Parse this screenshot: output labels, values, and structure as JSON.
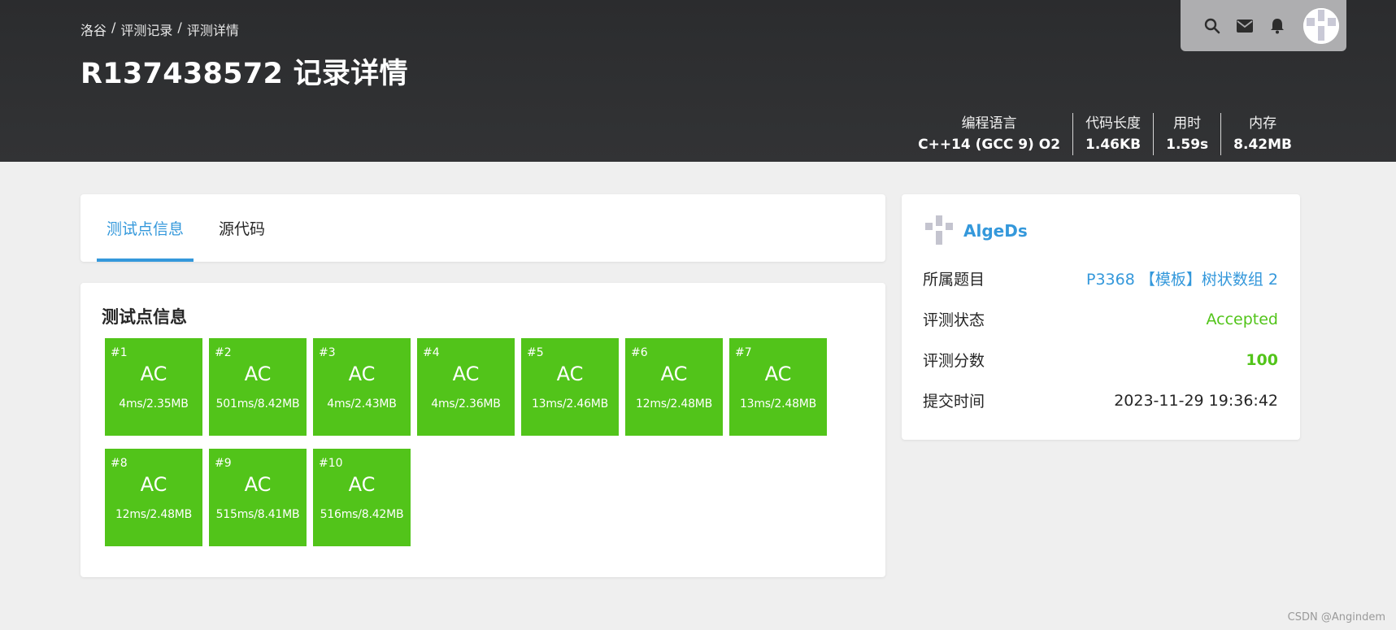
{
  "breadcrumb": {
    "home": "洛谷",
    "sep1": "/",
    "records": "评测记录",
    "sep2": "/",
    "current": "评测详情"
  },
  "page": {
    "title": "R137438572 记录详情"
  },
  "nav": {
    "icons": [
      "search-icon",
      "mail-icon",
      "bell-icon",
      "avatar"
    ]
  },
  "stats": [
    {
      "label": "编程语言",
      "value": "C++14 (GCC 9) O2"
    },
    {
      "label": "代码长度",
      "value": "1.46KB"
    },
    {
      "label": "用时",
      "value": "1.59s"
    },
    {
      "label": "内存",
      "value": "8.42MB"
    }
  ],
  "tabs": [
    {
      "label": "测试点信息",
      "active": true
    },
    {
      "label": "源代码",
      "active": false
    }
  ],
  "cases": {
    "title": "测试点信息",
    "items": [
      {
        "id": "#1",
        "status": "AC",
        "info": "4ms/2.35MB"
      },
      {
        "id": "#2",
        "status": "AC",
        "info": "501ms/8.42MB"
      },
      {
        "id": "#3",
        "status": "AC",
        "info": "4ms/2.43MB"
      },
      {
        "id": "#4",
        "status": "AC",
        "info": "4ms/2.36MB"
      },
      {
        "id": "#5",
        "status": "AC",
        "info": "13ms/2.46MB"
      },
      {
        "id": "#6",
        "status": "AC",
        "info": "12ms/2.48MB"
      },
      {
        "id": "#7",
        "status": "AC",
        "info": "13ms/2.48MB"
      },
      {
        "id": "#8",
        "status": "AC",
        "info": "12ms/2.48MB"
      },
      {
        "id": "#9",
        "status": "AC",
        "info": "515ms/8.41MB"
      },
      {
        "id": "#10",
        "status": "AC",
        "info": "516ms/8.42MB"
      }
    ]
  },
  "info": {
    "username": "AlgeDs",
    "problem_label": "所属题目",
    "problem_value": "P3368 【模板】树状数组 2",
    "status_label": "评测状态",
    "status_value": "Accepted",
    "score_label": "评测分数",
    "score_value": "100",
    "time_label": "提交时间",
    "time_value": "2023-11-29 19:36:42"
  },
  "watermark": "CSDN @Angindem",
  "colors": {
    "header_bg": "#2b2c2e",
    "accent": "#3498db",
    "accepted": "#52c41a",
    "page_bg": "#efefef"
  }
}
